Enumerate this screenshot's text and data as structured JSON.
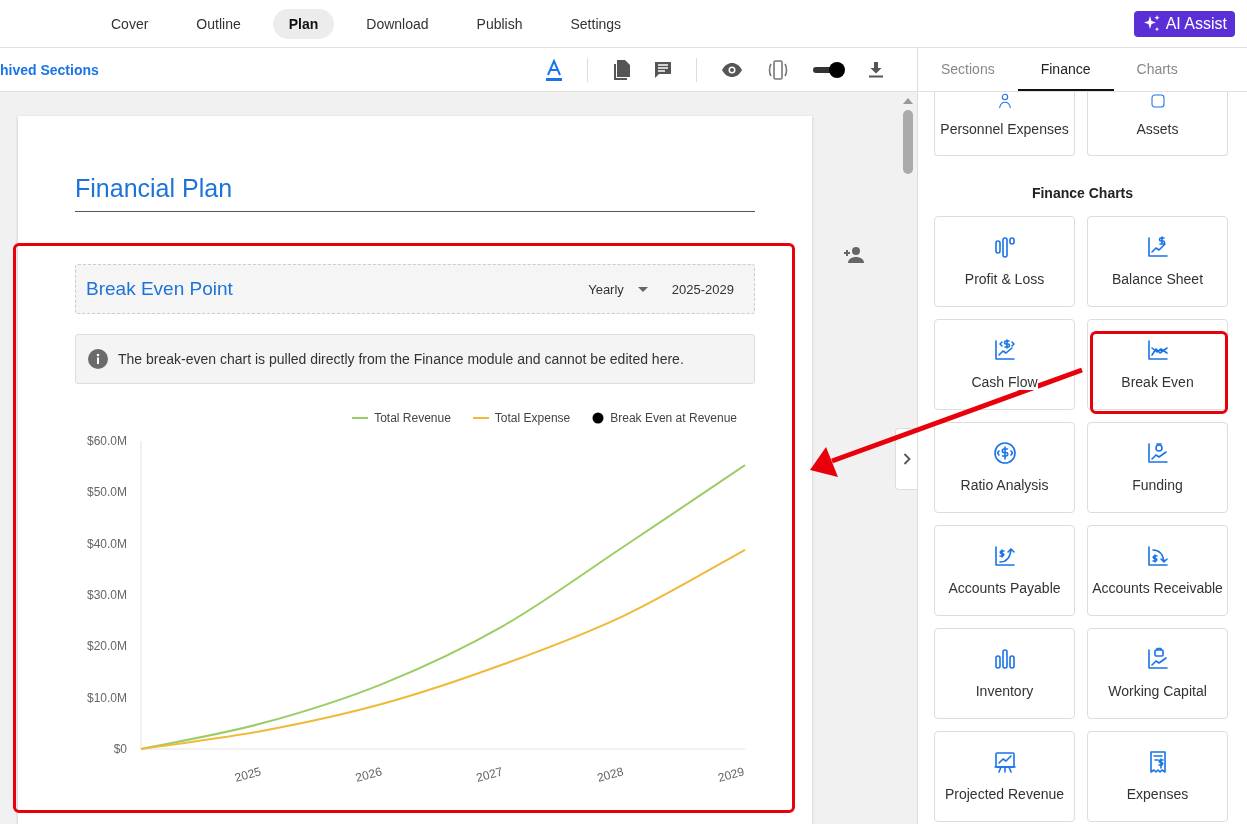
{
  "nav": {
    "tabs": [
      {
        "label": "Cover",
        "selected": false
      },
      {
        "label": "Outline",
        "selected": false
      },
      {
        "label": "Plan",
        "selected": true
      },
      {
        "label": "Download",
        "selected": false
      },
      {
        "label": "Publish",
        "selected": false
      },
      {
        "label": "Settings",
        "selected": false
      }
    ],
    "ai_button": "AI Assist"
  },
  "toolbar": {
    "link": "hived Sections",
    "preview_toggle": {
      "on": true
    }
  },
  "document": {
    "title": "Financial Plan",
    "block": {
      "title": "Break Even Point",
      "period": "Yearly",
      "range": "2025-2029",
      "info": "The break-even chart is pulled directly from the Finance module and cannot be edited here.",
      "chart_data": {
        "type": "line",
        "legend": "top-right",
        "x": [
          2024,
          2025,
          2026,
          2027,
          2028,
          2029
        ],
        "xlim": [
          2024,
          2029
        ],
        "ylim": [
          0,
          60
        ],
        "xticks": [
          2025,
          2026,
          2027,
          2028,
          2029
        ],
        "yticks": [
          {
            "value": 0,
            "label": "$0"
          },
          {
            "value": 10,
            "label": "$10.0M"
          },
          {
            "value": 20,
            "label": "$20.0M"
          },
          {
            "value": 30,
            "label": "$30.0M"
          },
          {
            "value": 40,
            "label": "$40.0M"
          },
          {
            "value": 50,
            "label": "$50.0M"
          },
          {
            "value": 60,
            "label": "$60.0M"
          }
        ],
        "series": [
          {
            "name": "Total Revenue",
            "color": "#9ccc65",
            "values": [
              0,
              5,
              12.7,
              24,
              39.5,
              55.3
            ]
          },
          {
            "name": "Total Expense",
            "color": "#f0b93a",
            "values": [
              0,
              3.5,
              8.8,
              16.5,
              26,
              38.8
            ]
          },
          {
            "name": "Break Even at Revenue",
            "color": "#000000",
            "values": [
              null,
              null,
              null,
              null,
              null,
              null
            ]
          }
        ]
      }
    }
  },
  "panel": {
    "tabs": [
      {
        "label": "Sections",
        "selected": false
      },
      {
        "label": "Finance",
        "selected": true
      },
      {
        "label": "Charts",
        "selected": false
      }
    ],
    "top_cards": [
      {
        "label": "Personnel Expenses"
      },
      {
        "label": "Assets"
      }
    ],
    "heading": "Finance Charts",
    "cards": [
      {
        "label": "Profit & Loss"
      },
      {
        "label": "Balance Sheet"
      },
      {
        "label": "Cash Flow"
      },
      {
        "label": "Break Even"
      },
      {
        "label": "Ratio Analysis"
      },
      {
        "label": "Funding"
      },
      {
        "label": "Accounts Payable"
      },
      {
        "label": "Accounts Receivable"
      },
      {
        "label": "Inventory"
      },
      {
        "label": "Working Capital"
      },
      {
        "label": "Projected Revenue"
      },
      {
        "label": "Expenses"
      }
    ]
  }
}
